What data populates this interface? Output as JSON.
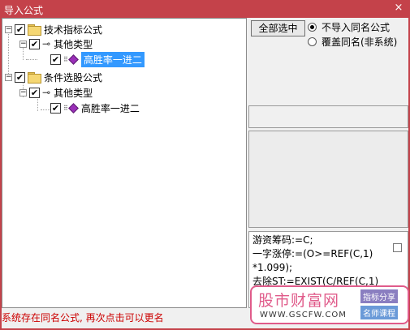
{
  "window": {
    "title": "导入公式",
    "close_glyph": "×"
  },
  "tree": {
    "nodes": [
      {
        "label": "技术指标公式",
        "expander": "−",
        "checked": true
      },
      {
        "label": "其他类型",
        "expander": "−",
        "checked": true
      },
      {
        "label": "高胜率一进二",
        "checked": true,
        "selected": true
      },
      {
        "label": "条件选股公式",
        "expander": "−",
        "checked": true
      },
      {
        "label": "其他类型",
        "expander": "−",
        "checked": true
      },
      {
        "label": "高胜率一进二",
        "checked": true,
        "selected": false
      }
    ]
  },
  "right_panel": {
    "select_all_label": "全部选中",
    "radio_options": [
      {
        "label": "不导入同名公式",
        "checked": true
      },
      {
        "label": "覆盖同名(非系统)",
        "checked": false
      }
    ],
    "formula_lines": [
      "游资筹码:=C;",
      "一字涨停:=(O>=REF(C,1)",
      "*1.099);",
      "去除ST:=EXIST(C/REF(C,1)"
    ]
  },
  "status_text": "系统存在同名公式, 再次点击可以更名",
  "watermark": {
    "logo": "股市财富网",
    "url": "WWW.GSCFW.COM",
    "tag1": "指标分享",
    "tag2": "名师课程"
  }
}
